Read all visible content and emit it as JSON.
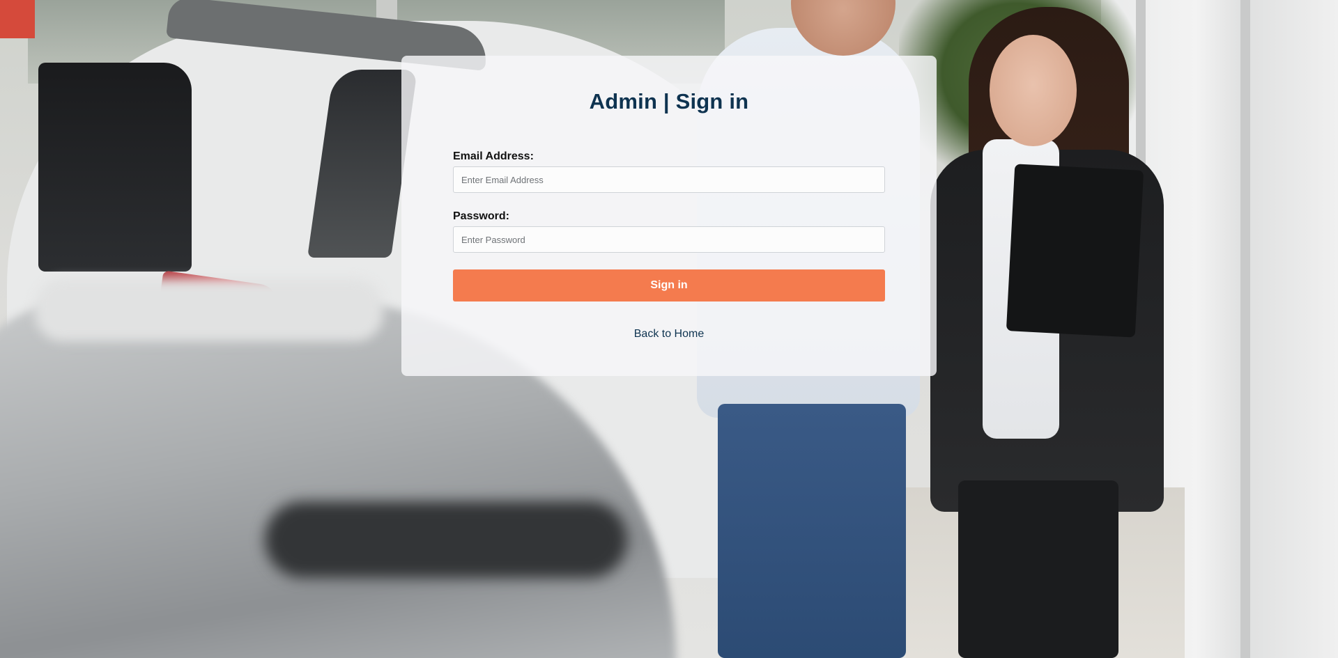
{
  "login": {
    "title": "Admin | Sign in",
    "email_label": "Email Address:",
    "email_placeholder": "Enter Email Address",
    "email_value": "",
    "password_label": "Password:",
    "password_placeholder": "Enter Password",
    "password_value": "",
    "signin_label": "Sign in",
    "back_link": "Back to Home"
  },
  "colors": {
    "title": "#0e3350",
    "button": "#f47b4e",
    "button_text": "#ffffff",
    "card_background": "rgba(246,247,249,0.82)"
  }
}
